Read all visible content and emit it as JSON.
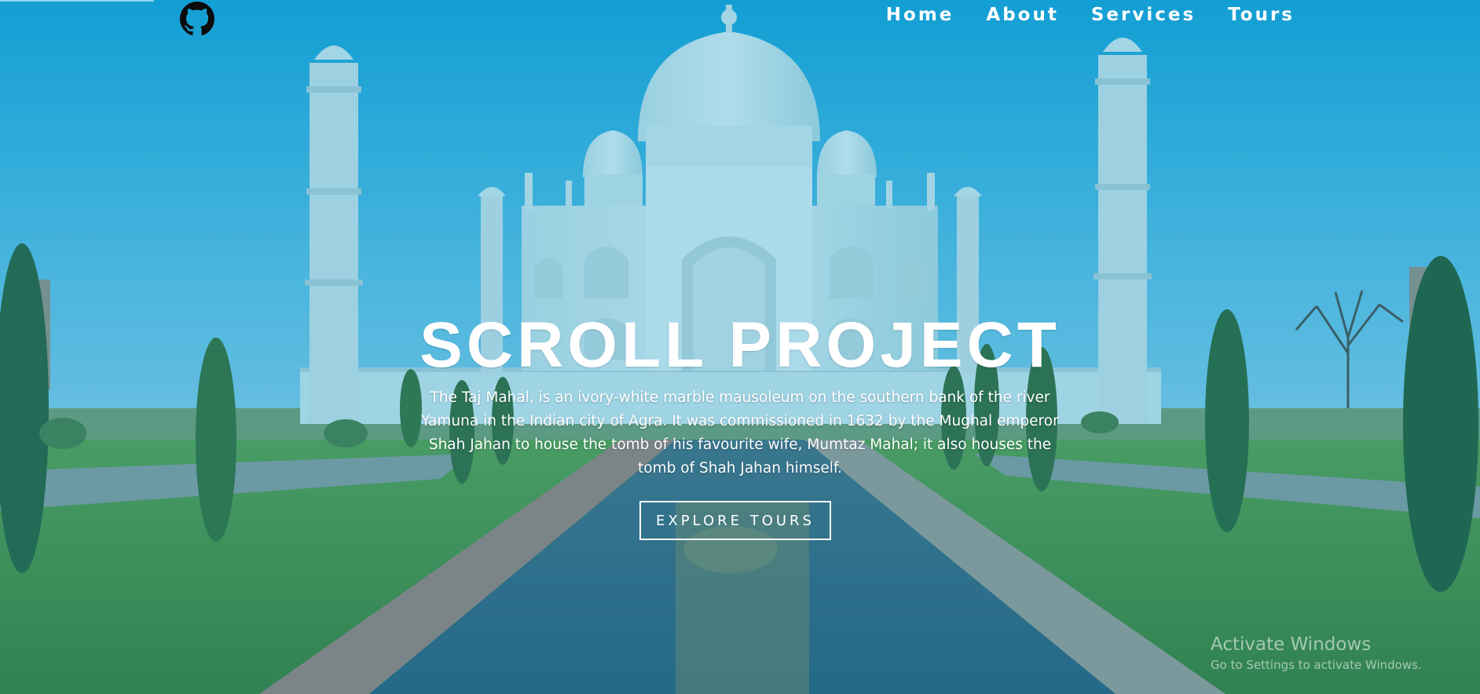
{
  "header": {
    "logo_icon": "github-icon",
    "nav": [
      {
        "label": "Home"
      },
      {
        "label": "About"
      },
      {
        "label": "Services"
      },
      {
        "label": "Tours"
      }
    ]
  },
  "hero": {
    "title": "SCROLL PROJECT",
    "text": "The Taj Mahal, is an ivory-white marble mausoleum on the southern bank of the river Yamuna in the Indian city of Agra. It was commissioned in 1632 by the Mughal emperor Shah Jahan to house the tomb of his favourite wife, Mumtaz Mahal; it also houses the tomb of Shah Jahan himself.",
    "button_label": "EXPLORE TOURS"
  },
  "watermark": {
    "title": "Activate Windows",
    "subtitle": "Go to Settings to activate Windows."
  },
  "colors": {
    "sky": "#1fa7d9",
    "overlay": "#0f96c8",
    "text": "#ffffff"
  }
}
